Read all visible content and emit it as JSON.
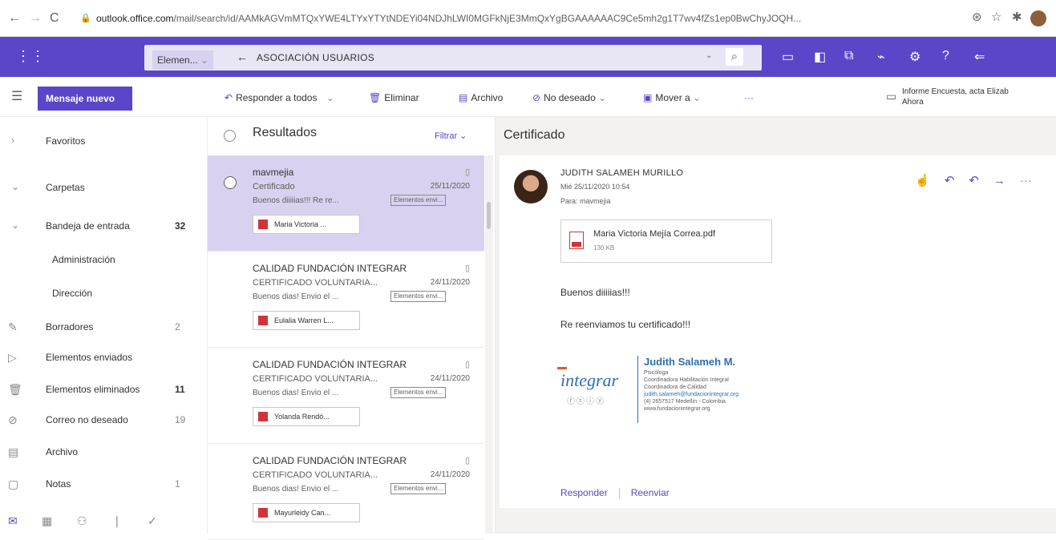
{
  "browser": {
    "url_host": "outlook.office.com",
    "url_path": "/mail/search/id/AAMkAGVmMTQxYWE4LTYxYTYtNDEYi04NDJhLWI0MGFkNjE3MmQxYgBGAAAAAAC9Ce5mh2g1T7wv4fZs1ep0BwChyJOQH..."
  },
  "suite": {
    "scope_label": "Elemen...",
    "search_text": "ASOCIACIÓN USUARIOS"
  },
  "commands": {
    "new_message": "Mensaje nuevo",
    "reply_all": "Responder a todos",
    "delete": "Eliminar",
    "archive": "Archivo",
    "junk": "No deseado",
    "move": "Mover a",
    "more": "···",
    "reminder_title": "Informe Encuesta, acta Elizab",
    "reminder_time": "Ahora"
  },
  "sidebar": {
    "favorites": "Favoritos",
    "folders": "Carpetas",
    "items": [
      {
        "label": "Bandeja de entrada",
        "count": "32"
      },
      {
        "label": "Administración",
        "count": ""
      },
      {
        "label": "Dirección",
        "count": ""
      },
      {
        "label": "Borradores",
        "count": "2"
      },
      {
        "label": "Elementos enviados",
        "count": ""
      },
      {
        "label": "Elementos eliminados",
        "count": "11"
      },
      {
        "label": "Correo no deseado",
        "count": "19"
      },
      {
        "label": "Archivo",
        "count": ""
      },
      {
        "label": "Notas",
        "count": "1"
      }
    ]
  },
  "list": {
    "title": "Resultados",
    "filter": "Filtrar",
    "messages": [
      {
        "sender": "mavmejia",
        "subject": "Certificado",
        "date": "25/11/2020",
        "preview": "Buenos diiiiias!!! Re re...",
        "tag": "Elementos envi...",
        "attachment": "Maria Victoria ..."
      },
      {
        "sender": "CALIDAD FUNDACIÓN INTEGRAR",
        "subject": "CERTIFICADO VOLUNTARIA...",
        "date": "24/11/2020",
        "preview": "Buenos dias! Envio el ...",
        "tag": "Elementos envi...",
        "attachment": "Eulalia Warren L..."
      },
      {
        "sender": "CALIDAD FUNDACIÓN INTEGRAR",
        "subject": "CERTIFICADO VOLUNTARIA...",
        "date": "24/11/2020",
        "preview": "Buenos dias! Envio el ...",
        "tag": "Elementos envi...",
        "attachment": "Yolanda Rendó..."
      },
      {
        "sender": "CALIDAD FUNDACIÓN INTEGRAR",
        "subject": "CERTIFICADO VOLUNTARIA...",
        "date": "24/11/2020",
        "preview": "Buenos dias! Envio el ...",
        "tag": "Elementos envi...",
        "attachment": "Mayurleidy Can..."
      }
    ]
  },
  "reading": {
    "title": "Certificado",
    "from": "JUDITH SALAMEH MURILLO",
    "when": "Mié 25/11/2020 10:54",
    "to": "Para: mavmejia",
    "attachment_name": "Maria Victoria Mejía Correa.pdf",
    "attachment_size": "130 KB",
    "body_line1": "Buenos diiiiias!!!",
    "body_line2": "Re reenviamos tu certificado!!!",
    "signature": {
      "logo": "integrar",
      "name": "Judith Salameh M.",
      "lines": [
        "Psicóloga",
        "Coordinadora Habilitación Integral",
        "Coordinadora de Calidad",
        "judith.salameh@fundacionintegrar.org",
        "(4) 2657517  Medellín - Colombia",
        "www.fundacionintegrar.org"
      ]
    },
    "reply": "Responder",
    "forward": "Reenviar"
  }
}
